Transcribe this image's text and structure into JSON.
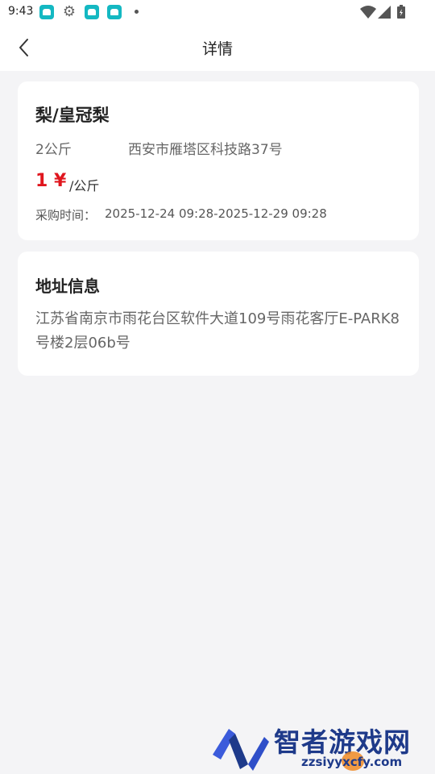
{
  "status_bar": {
    "time": "9:43",
    "icons": [
      "app-icon",
      "settings-icon",
      "app-icon",
      "app-icon",
      "dot-icon",
      "wifi-icon",
      "signal-icon",
      "battery-icon"
    ]
  },
  "header": {
    "back_icon": "chevron-left-icon",
    "title": "详情"
  },
  "product": {
    "name": "梨/皇冠梨",
    "weight": "2公斤",
    "location": "西安市雁塔区科技路37号",
    "price": "1 ¥",
    "price_color": "#e0161e",
    "unit": "/公斤",
    "time_label": "采购时间：",
    "time_value": "2025-12-24 09:28-2025-12-29 09:28"
  },
  "address_section": {
    "title": "地址信息",
    "address": "江苏省南京市雨花台区软件大道109号雨花客厅E-PARK8号楼2层06b号"
  },
  "watermark": {
    "text": "智者游戏网",
    "url": "zzsiyyxcfy.com"
  }
}
